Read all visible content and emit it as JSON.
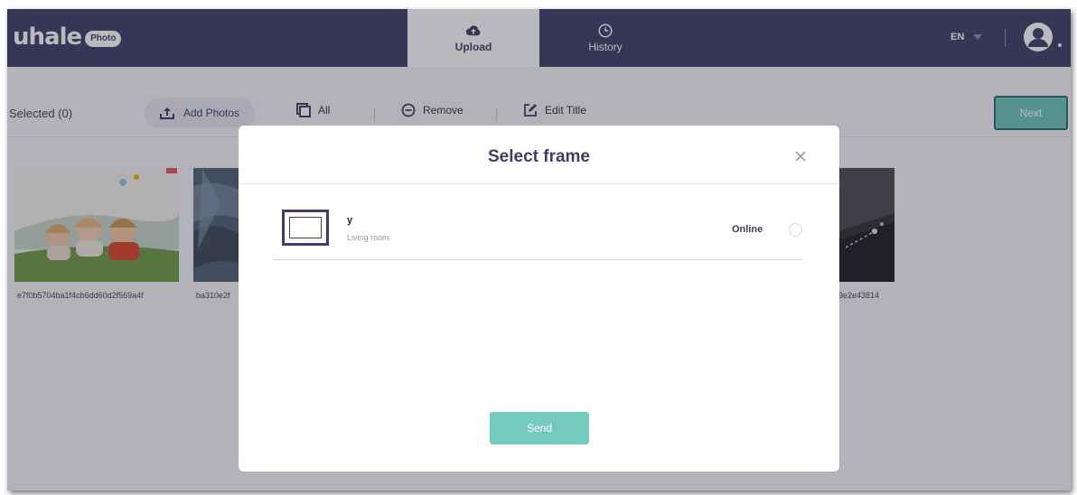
{
  "header": {
    "logo_word": "uhale",
    "logo_badge": "Photo",
    "tabs": [
      {
        "label": "Upload",
        "icon": "cloud-upload-icon",
        "active": true
      },
      {
        "label": "History",
        "icon": "clock-icon",
        "active": false
      }
    ],
    "language": "EN"
  },
  "toolbar": {
    "selected_label": "Selected (0)",
    "add_photos_label": "Add Photos",
    "all_label": "All",
    "remove_label": "Remove",
    "edit_title_label": "Edit Title",
    "next_label": "Next"
  },
  "photos": [
    {
      "caption": "e7f0b5704ba1f4cb6dd60d2f569a4f"
    },
    {
      "caption": "ba310e2f"
    },
    {
      "caption": "9e2e43814"
    }
  ],
  "modal": {
    "title": "Select frame",
    "frames": [
      {
        "name": "y",
        "room": "Living room",
        "status": "Online",
        "selected": false
      }
    ],
    "send_label": "Send"
  },
  "colors": {
    "brand": "#3d3e66",
    "accent": "#6cc5b9",
    "send": "#74cbbd"
  }
}
